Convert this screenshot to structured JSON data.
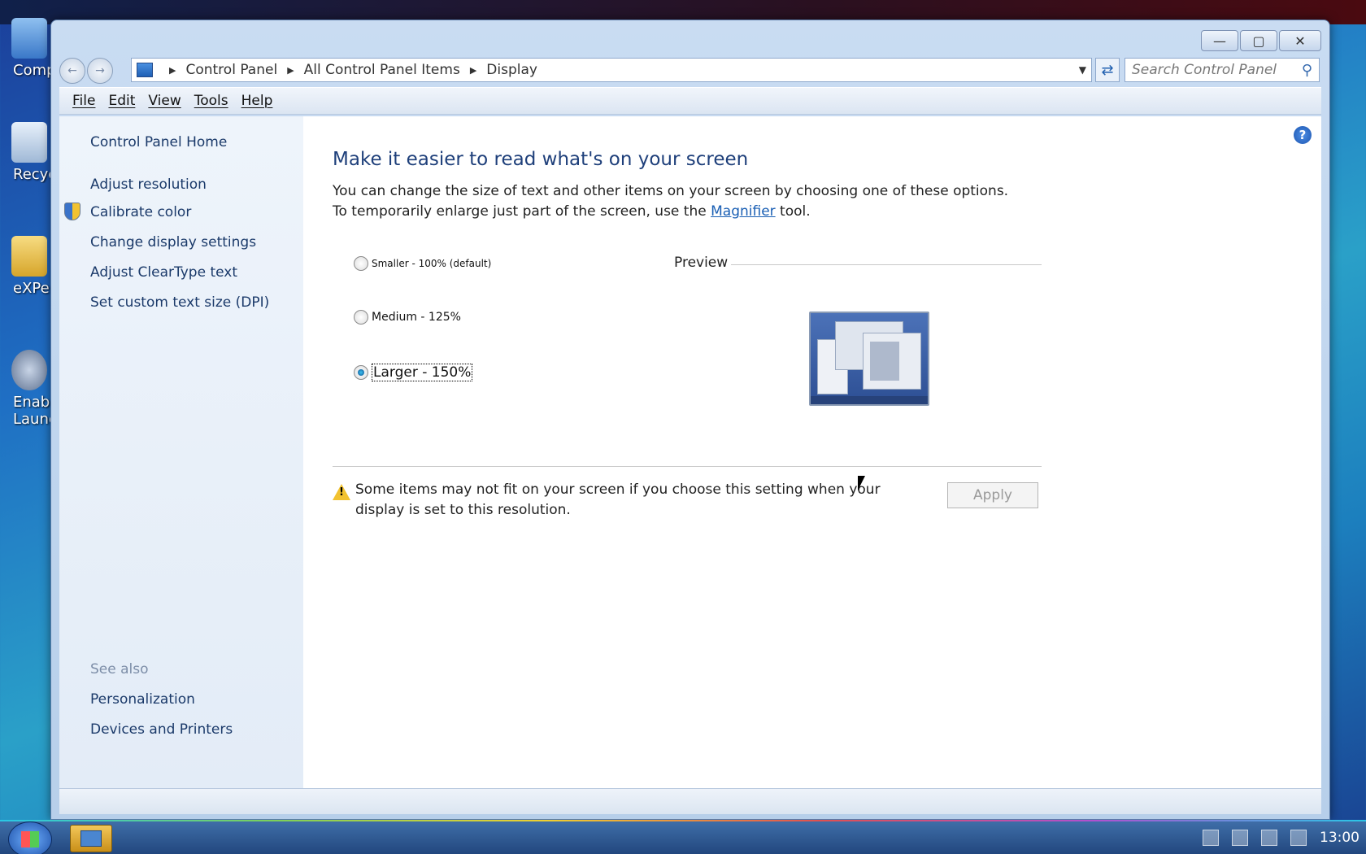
{
  "desktop": {
    "icons": [
      {
        "label": "Comp"
      },
      {
        "label": "Recycl"
      },
      {
        "label": "eXPeri"
      },
      {
        "label": "Enable"
      },
      {
        "label": "Launc"
      }
    ]
  },
  "window": {
    "address": {
      "crumbs": [
        "Control Panel",
        "All Control Panel Items",
        "Display"
      ]
    },
    "search_placeholder": "Search Control Panel",
    "menu": [
      "File",
      "Edit",
      "View",
      "Tools",
      "Help"
    ]
  },
  "sidebar": {
    "home": "Control Panel Home",
    "links": [
      "Adjust resolution",
      "Calibrate color",
      "Change display settings",
      "Adjust ClearType text",
      "Set custom text size (DPI)"
    ],
    "see_also_heading": "See also",
    "see_also": [
      "Personalization",
      "Devices and Printers"
    ]
  },
  "main": {
    "title": "Make it easier to read what's on your screen",
    "desc_part1": "You can change the size of text and other items on your screen by choosing one of these options. To temporarily enlarge just part of the screen, use the ",
    "desc_link": "Magnifier",
    "desc_part2": " tool.",
    "options": [
      {
        "label": "Smaller - 100% (default)",
        "checked": false
      },
      {
        "label": "Medium - 125%",
        "checked": false
      },
      {
        "label": "Larger - 150%",
        "checked": true
      }
    ],
    "preview_label": "Preview",
    "warning": "Some items may not fit on your screen if you choose this setting when your display is set to this resolution.",
    "apply_label": "Apply"
  },
  "taskbar": {
    "clock": "13:00"
  }
}
